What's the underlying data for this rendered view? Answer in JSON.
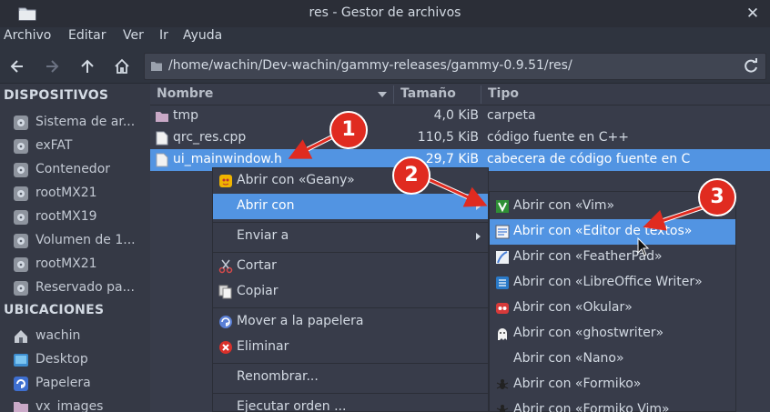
{
  "window": {
    "title": "res - Gestor de archivos"
  },
  "menubar": [
    "Archivo",
    "Editar",
    "Ver",
    "Ir",
    "Ayuda"
  ],
  "toolbar": {
    "path": "/home/wachin/Dev-wachin/gammy-releases/gammy-0.9.51/res/"
  },
  "sidebar": {
    "devices_header": "DISPOSITIVOS",
    "devices": [
      "Sistema de ar...",
      "exFAT",
      "Contenedor",
      "rootMX21",
      "rootMX19",
      "Volumen de 1...",
      "rootMX21",
      "Reservado pa..."
    ],
    "places_header": "UBICACIONES",
    "places": [
      {
        "label": "wachin",
        "icon": "home-icon"
      },
      {
        "label": "Desktop",
        "icon": "desktop-icon"
      },
      {
        "label": "Papelera",
        "icon": "trash-icon"
      },
      {
        "label": "vx_images",
        "icon": "folder-icon"
      }
    ]
  },
  "columns": {
    "name": "Nombre",
    "size": "Tamaño",
    "type": "Tipo"
  },
  "files": [
    {
      "name": "tmp",
      "size": "4,0 KiB",
      "type": "carpeta",
      "icon": "folder-icon"
    },
    {
      "name": "qrc_res.cpp",
      "size": "110,5 KiB",
      "type": "código fuente en C++",
      "icon": "file-icon"
    },
    {
      "name": "ui_mainwindow.h",
      "size": "29,7 KiB",
      "type": "cabecera de código fuente en C",
      "icon": "file-icon",
      "selected": true
    }
  ],
  "context_menu": {
    "open_geany": "Abrir con «Geany»",
    "open_with": "Abrir con",
    "send_to": "Enviar a",
    "cut": "Cortar",
    "copy": "Copiar",
    "move_trash": "Mover a la papelera",
    "delete": "Eliminar",
    "rename": "Renombrar...",
    "run_command": "Ejecutar orden ..."
  },
  "open_with_submenu": [
    {
      "label": "Abrir con «Vim»",
      "icon": "vim-icon"
    },
    {
      "label": "Abrir con «Editor de textos»",
      "icon": "text-editor-icon",
      "highlighted": true
    },
    {
      "label": "Abrir con «FeatherPad»",
      "icon": "featherpad-icon"
    },
    {
      "label": "Abrir con «LibreOffice Writer»",
      "icon": "writer-icon"
    },
    {
      "label": "Abrir con «Okular»",
      "icon": "okular-icon"
    },
    {
      "label": "Abrir con «ghostwriter»",
      "icon": "ghostwriter-icon"
    },
    {
      "label": "Abrir con «Nano»",
      "icon": "nano-icon"
    },
    {
      "label": "Abrir con «Formiko»",
      "icon": "formiko-icon"
    },
    {
      "label": "Abrir con «Formiko Vim»",
      "icon": "formiko-icon"
    }
  ],
  "annotations": [
    "1",
    "2",
    "3"
  ],
  "colors": {
    "accent": "#5294e2",
    "badge": "#e02b20",
    "bg": "#383c4a",
    "sidebar": "#353945"
  }
}
